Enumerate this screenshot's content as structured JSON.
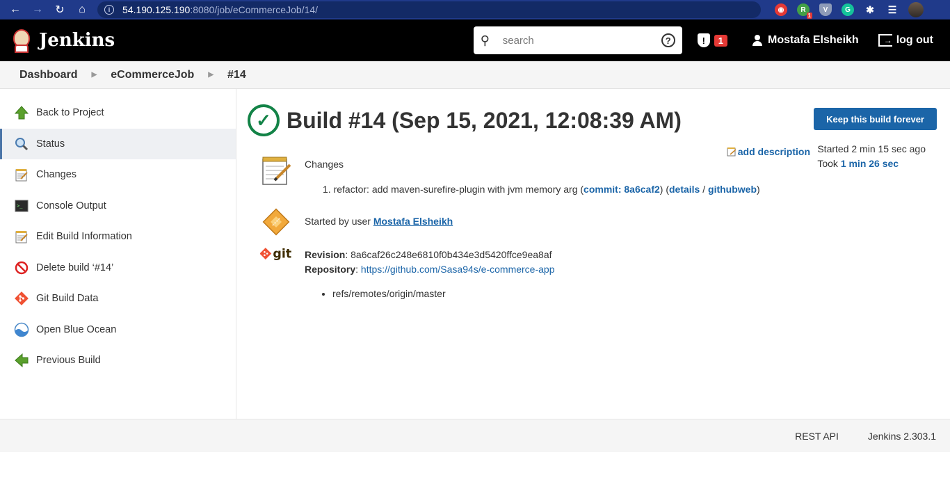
{
  "browser": {
    "url_host": "54.190.125.190",
    "url_path": ":8080/job/eCommerceJob/14/"
  },
  "header": {
    "app_name": "Jenkins",
    "search_placeholder": "search",
    "security_count": "1",
    "user_name": "Mostafa Elsheikh",
    "logout_label": "log out"
  },
  "breadcrumb": [
    "Dashboard",
    "eCommerceJob",
    "#14"
  ],
  "sidebar": {
    "items": [
      {
        "label": "Back to Project",
        "icon": "up-arrow-icon"
      },
      {
        "label": "Status",
        "icon": "magnifier-icon"
      },
      {
        "label": "Changes",
        "icon": "notepad-icon"
      },
      {
        "label": "Console Output",
        "icon": "terminal-icon"
      },
      {
        "label": "Edit Build Information",
        "icon": "notepad-icon"
      },
      {
        "label": "Delete build ‘#14’",
        "icon": "no-entry-icon"
      },
      {
        "label": "Git Build Data",
        "icon": "git-icon"
      },
      {
        "label": "Open Blue Ocean",
        "icon": "blue-ocean-icon"
      },
      {
        "label": "Previous Build",
        "icon": "left-arrow-icon"
      }
    ]
  },
  "build": {
    "title": "Build #14 (Sep 15, 2021, 12:08:39 AM)",
    "keep_label": "Keep this build forever",
    "add_description": "add description",
    "started_ago": "Started 2 min 15 sec ago",
    "took_prefix": "Took",
    "took_value": "1 min 26 sec"
  },
  "changes": {
    "heading": "Changes",
    "item_index": "1.",
    "item_text": "refactor: add maven-surefire-plugin with jvm memory arg (",
    "commit_label": "commit: 8a6caf2",
    "mid": ") (",
    "details_label": "details",
    "slash": " / ",
    "githubweb_label": "githubweb",
    "end": ")"
  },
  "cause": {
    "prefix": "Started by user",
    "user": "Mostafa Elsheikh"
  },
  "git": {
    "revision_label": "Revision",
    "revision": "8a6caf26c248e6810f0b434e3d5420ffce9ea8af",
    "repository_label": "Repository",
    "repository": "https://github.com/Sasa94s/e-commerce-app",
    "branch": "refs/remotes/origin/master"
  },
  "footer": {
    "rest_api": "REST API",
    "version": "Jenkins 2.303.1"
  }
}
